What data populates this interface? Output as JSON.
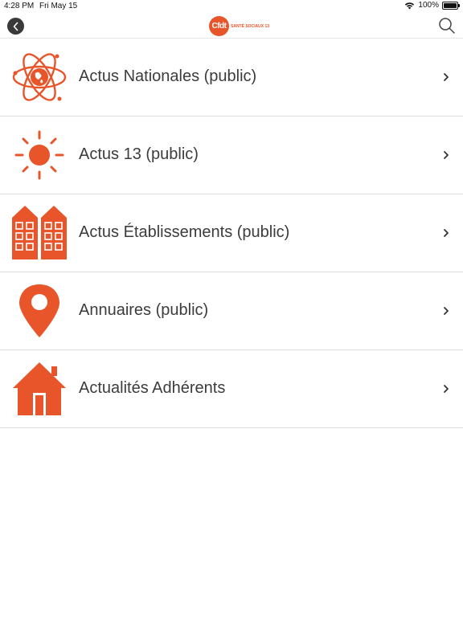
{
  "status_bar": {
    "time": "4:28 PM",
    "date": "Fri May 15",
    "battery": "100%",
    "battery_level": 1.0
  },
  "nav": {
    "back_icon": "chevron-left-icon",
    "logo_text": "Cfdt",
    "logo_subtext": "SANTÉ SOCIAUX 13",
    "search_icon": "search-icon"
  },
  "colors": {
    "accent": "#e8552a",
    "text": "#3c3c3c",
    "divider": "#dcdcdc"
  },
  "menu": {
    "items": [
      {
        "label": "Actus Nationales (public)",
        "icon": "atom-globe-icon"
      },
      {
        "label": "Actus 13 (public)",
        "icon": "sun-icon"
      },
      {
        "label": "Actus Établissements (public)",
        "icon": "buildings-icon"
      },
      {
        "label": "Annuaires (public)",
        "icon": "map-pin-icon"
      },
      {
        "label": "Actualités Adhérents",
        "icon": "house-icon"
      }
    ]
  }
}
